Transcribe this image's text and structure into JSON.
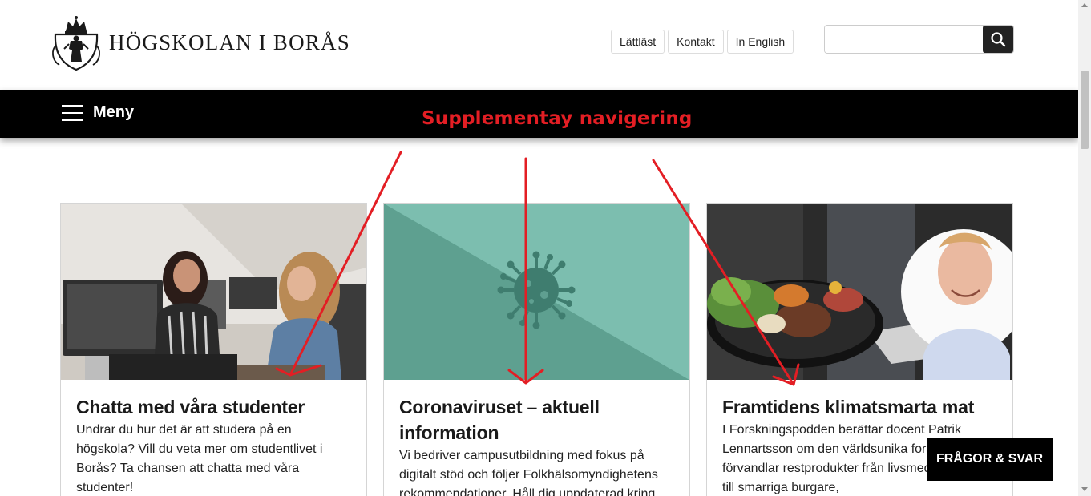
{
  "header": {
    "logo_text": "HÖGSKOLAN I BORÅS",
    "top_links": [
      "Lättläst",
      "Kontakt",
      "In English"
    ],
    "search": {
      "value": "",
      "placeholder": ""
    }
  },
  "nav": {
    "menu_label": "Meny"
  },
  "annotation": {
    "text": "Supplementay navigering",
    "color": "#e31e24"
  },
  "cards": [
    {
      "title": "Chatta med våra studenter",
      "text": "Undrar du hur det är att studera på en högskola? Vill du veta mer om studentlivet i Borås? Ta chansen att chatta med våra studenter!"
    },
    {
      "title": "Coronaviruset – aktuell information",
      "text": "Vi bedriver campusutbildning med fokus på digitalt stöd och följer Folkhälsomyndighetens rekommendationer. Håll dig uppdaterad kring"
    },
    {
      "title": "Framtidens klimatsmarta mat",
      "text": "I Forskningspodden berättar docent Patrik Lennartsson om den världsunika forskning som förvandlar restprodukter från livsmedelsindustrin till smarriga burgare,"
    }
  ],
  "faq_button": {
    "label": "FRÅGOR & SVAR"
  },
  "colors": {
    "nav_bg": "#000000",
    "corona_teal": "#74b8a8",
    "accent_red": "#e31e24"
  }
}
